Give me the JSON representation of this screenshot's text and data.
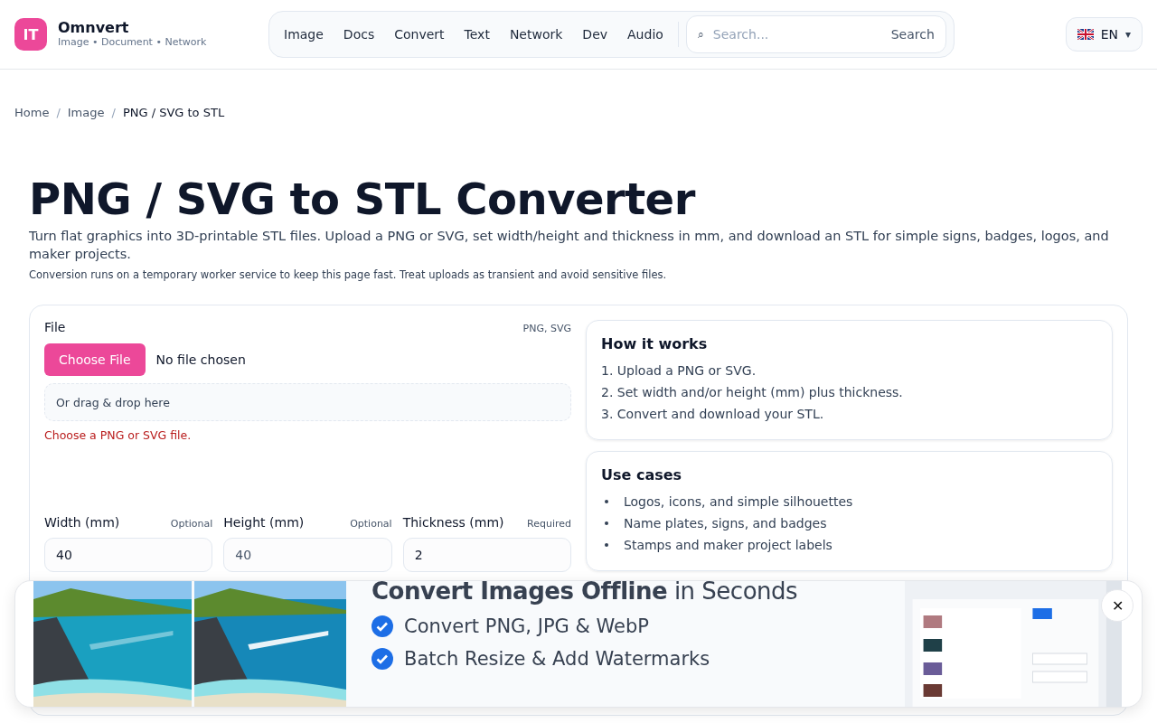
{
  "brand": {
    "logo": "IT",
    "name": "Omnvert",
    "tagline": "Image • Document • Network"
  },
  "nav": [
    {
      "label": "Image"
    },
    {
      "label": "Docs"
    },
    {
      "label": "Convert"
    },
    {
      "label": "Text"
    },
    {
      "label": "Network"
    },
    {
      "label": "Dev"
    },
    {
      "label": "Audio"
    }
  ],
  "search": {
    "icon": "⌕",
    "placeholder": "Search...",
    "button": "Search"
  },
  "language": {
    "code": "EN",
    "caret": "▾"
  },
  "breadcrumb": [
    {
      "label": "Home",
      "current": false
    },
    {
      "label": "Image",
      "current": false
    },
    {
      "label": "PNG / SVG to STL",
      "current": true
    }
  ],
  "breadcrumb_separator": "/",
  "title": "PNG / SVG to STL Converter",
  "description": "Turn flat graphics into 3D-printable STL files. Upload a PNG or SVG, set width/height and thickness in mm, and download an STL for simple signs, badges, logos, and maker projects.",
  "note": "Conversion runs on a temporary worker service to keep this page fast. Treat uploads as transient and avoid sensitive files.",
  "file": {
    "label": "File",
    "formats": "PNG, SVG",
    "button": "Choose File",
    "status": "No file chosen",
    "dropzone": "Or drag & drop here",
    "error": "Choose a PNG or SVG file."
  },
  "fields": [
    {
      "label": "Width (mm)",
      "hint": "Optional",
      "value": "40"
    },
    {
      "label": "Height (mm)",
      "hint": "Optional",
      "placeholder": "40"
    },
    {
      "label": "Thickness (mm)",
      "hint": "Required",
      "value": "2"
    }
  ],
  "info_cards": [
    {
      "title": "How it works",
      "kind": "ordered",
      "items": [
        "1. Upload a PNG or SVG.",
        "2. Set width and/or height (mm) plus thickness.",
        "3. Convert and download your STL."
      ]
    },
    {
      "title": "Use cases",
      "kind": "bulleted",
      "items": [
        "Logos, icons, and simple silhouettes",
        "Name plates, signs, and badges",
        "Stamps and maker project labels"
      ]
    }
  ],
  "ad": {
    "headline": "**Convert Images Offline** in Seconds",
    "bullets": [
      "Convert PNG, JPG & WebP",
      "Batch Resize & Add Watermarks"
    ],
    "close": "✕"
  }
}
